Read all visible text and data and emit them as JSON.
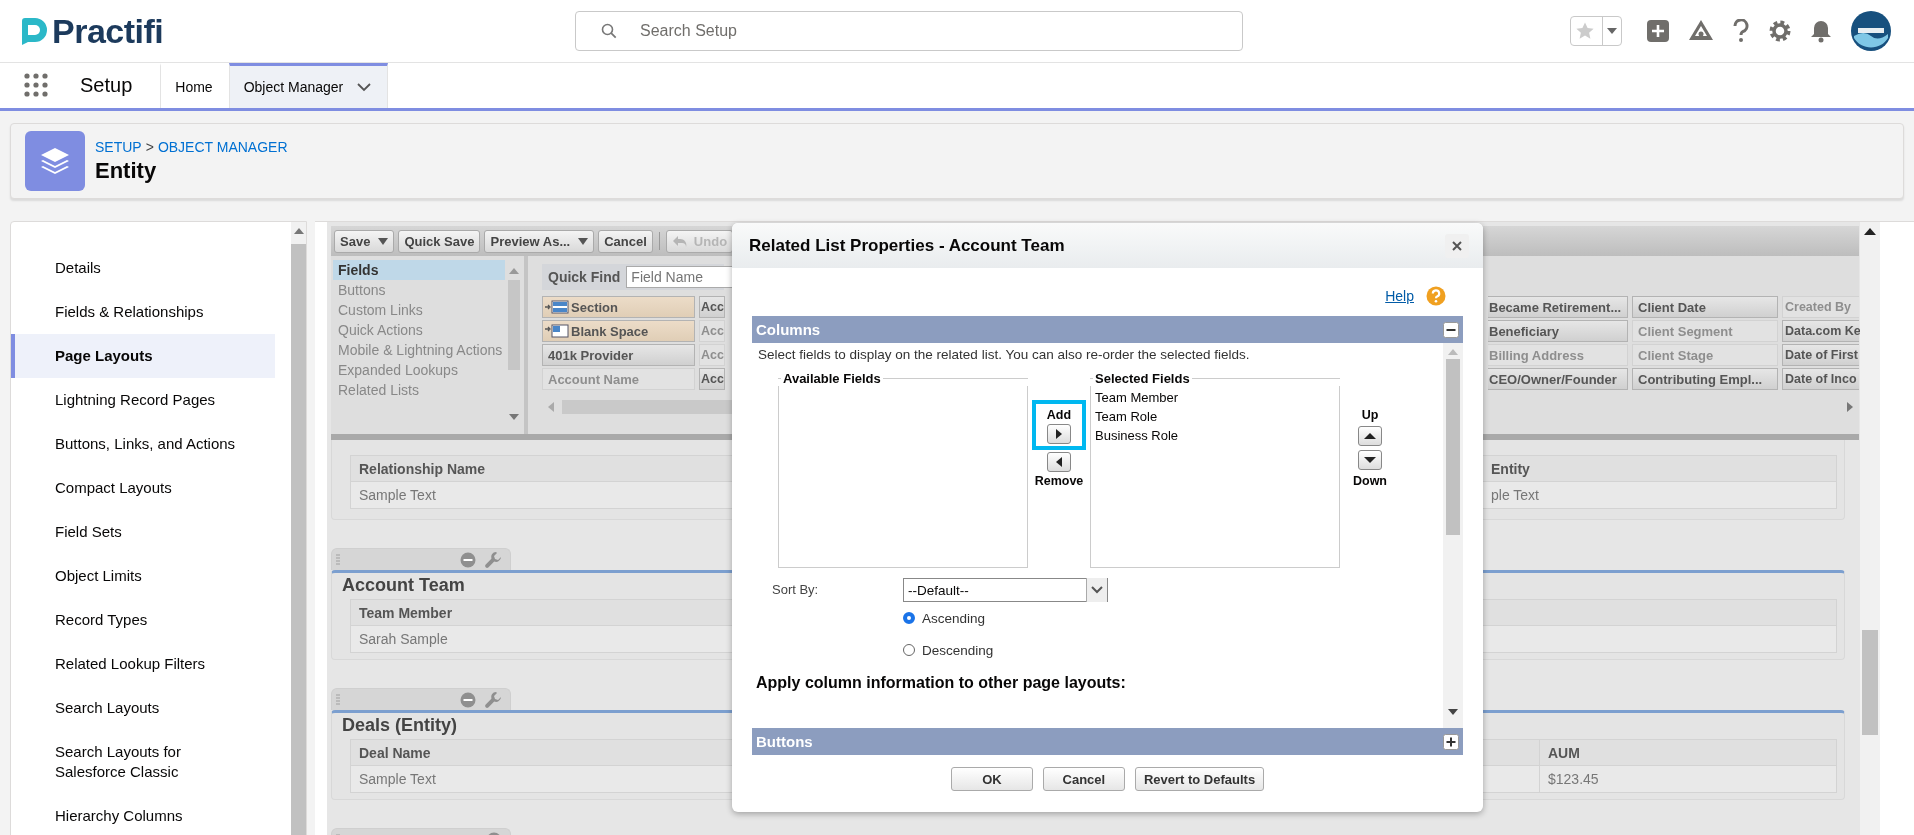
{
  "header": {
    "logo": "Practifi",
    "search": {
      "placeholder": "Search Setup"
    }
  },
  "nav": {
    "app_name": "Setup",
    "tabs": [
      {
        "label": "Home",
        "selected": false,
        "menu": false
      },
      {
        "label": "Object Manager",
        "selected": true,
        "menu": true
      }
    ]
  },
  "breadcrumb": {
    "items": [
      "SETUP",
      "OBJECT MANAGER"
    ],
    "separator": ">",
    "title": "Entity"
  },
  "sidebar": {
    "items": [
      {
        "label": "Details",
        "selected": false
      },
      {
        "label": "Fields & Relationships",
        "selected": false
      },
      {
        "label": "Page Layouts",
        "selected": true
      },
      {
        "label": "Lightning Record Pages",
        "selected": false
      },
      {
        "label": "Buttons, Links, and Actions",
        "selected": false
      },
      {
        "label": "Compact Layouts",
        "selected": false
      },
      {
        "label": "Field Sets",
        "selected": false
      },
      {
        "label": "Object Limits",
        "selected": false
      },
      {
        "label": "Record Types",
        "selected": false
      },
      {
        "label": "Related Lookup Filters",
        "selected": false
      },
      {
        "label": "Search Layouts",
        "selected": false
      },
      {
        "label": "Search Layouts for Salesforce Classic",
        "selected": false
      },
      {
        "label": "Hierarchy Columns",
        "selected": false
      }
    ]
  },
  "palette": {
    "toolbar": [
      {
        "label": "Save",
        "dropdown": true,
        "disabled": false
      },
      {
        "label": "Quick Save",
        "dropdown": false,
        "disabled": false
      },
      {
        "label": "Preview As...",
        "dropdown": true,
        "disabled": false
      },
      {
        "label": "Cancel",
        "dropdown": false,
        "disabled": false
      },
      {
        "label": "Undo",
        "dropdown": false,
        "disabled": true
      }
    ],
    "categories": [
      {
        "label": "Fields",
        "selected": true
      },
      {
        "label": "Buttons",
        "selected": false
      },
      {
        "label": "Custom Links",
        "selected": false
      },
      {
        "label": "Quick Actions",
        "selected": false
      },
      {
        "label": "Mobile & Lightning Actions",
        "selected": false
      },
      {
        "label": "Expanded Lookups",
        "selected": false
      },
      {
        "label": "Related Lists",
        "selected": false
      }
    ],
    "quick_find": {
      "label": "Quick Find",
      "placeholder": "Field Name"
    },
    "left_field_columns": [
      {
        "items": [
          {
            "label": "Section",
            "kind": "section",
            "used": false
          },
          {
            "label": "Blank Space",
            "kind": "blank",
            "used": false
          },
          {
            "label": "401k Provider",
            "kind": "field",
            "used": false
          },
          {
            "label": "Account Name",
            "kind": "field",
            "used": true
          }
        ]
      },
      {
        "items": [
          {
            "label": "Acc",
            "kind": "field",
            "used": false
          },
          {
            "label": "Acc",
            "kind": "field",
            "used": true
          },
          {
            "label": "Acc",
            "kind": "field",
            "used": true
          },
          {
            "label": "Acc",
            "kind": "field",
            "used": false
          }
        ]
      }
    ],
    "right_field_columns": [
      {
        "items": [
          {
            "label": "Became Retirement...",
            "used": false
          },
          {
            "label": "Beneficiary",
            "used": false
          },
          {
            "label": "Billing Address",
            "used": true
          },
          {
            "label": "CEO/Owner/Founder",
            "used": false
          }
        ]
      },
      {
        "items": [
          {
            "label": "Client Date",
            "used": false
          },
          {
            "label": "Client Segment",
            "used": true
          },
          {
            "label": "Client Stage",
            "used": true
          },
          {
            "label": "Contributing Empl...",
            "used": false
          }
        ]
      },
      {
        "items": [
          {
            "label": "Created By",
            "used": true
          },
          {
            "label": "Data.com Ke",
            "used": false
          },
          {
            "label": "Date of First",
            "used": false
          },
          {
            "label": "Date of Inco",
            "used": false
          }
        ]
      }
    ]
  },
  "layout": {
    "sections": [
      {
        "columns": [
          {
            "header": "Relationship Name",
            "value": "Sample Text"
          },
          {
            "header": "Entity",
            "value": "ple Text"
          }
        ]
      },
      {
        "toolbar": {
          "remove": true,
          "edit": true
        },
        "title": "Account Team",
        "columns": [
          {
            "header": "Team Member",
            "value": "Sarah Sample"
          }
        ]
      },
      {
        "toolbar": {
          "remove": true,
          "edit": true
        },
        "title": "Deals (Entity)",
        "columns": [
          {
            "header": "Deal Name",
            "value": "Sample Text"
          },
          {
            "header": "AUM",
            "value": "$123.45"
          }
        ]
      },
      {
        "toolbar": {
          "remove": true,
          "edit": false
        }
      }
    ]
  },
  "dialog": {
    "title": "Related List Properties - Account Team",
    "help": "Help",
    "panels": [
      {
        "title": "Columns",
        "expanded": true
      },
      {
        "title": "Buttons",
        "expanded": false
      }
    ],
    "description": "Select fields to display on the related list. You can also re-order the selected fields.",
    "available_label": "Available Fields",
    "selected_label": "Selected Fields",
    "selected_items": [
      "Team Member",
      "Team Role",
      "Business Role"
    ],
    "add": "Add",
    "remove": "Remove",
    "up": "Up",
    "down": "Down",
    "add_highlighted": true,
    "sort_by": {
      "label": "Sort By:",
      "value": "--Default--"
    },
    "sort_order": [
      {
        "label": "Ascending",
        "selected": true
      },
      {
        "label": "Descending",
        "selected": false
      }
    ],
    "apply_heading": "Apply column information to other page layouts:",
    "buttons": [
      "OK",
      "Cancel",
      "Revert to Defaults"
    ]
  }
}
